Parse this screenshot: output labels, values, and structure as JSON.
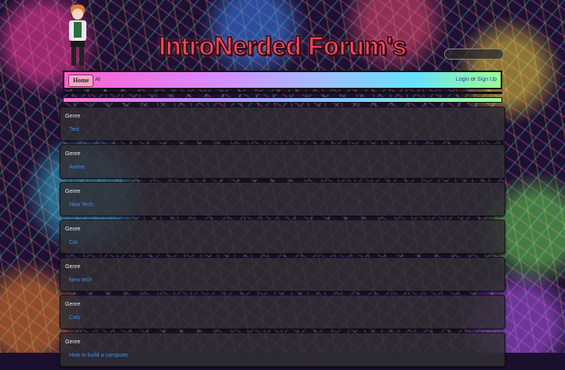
{
  "site": {
    "title": "IntroNerded Forum's"
  },
  "nav": {
    "home": "Home",
    "all": "All",
    "login": "Login",
    "or": "or",
    "signup": "Sign Up"
  },
  "categories": [
    {
      "genre": "Genre",
      "name": "Test"
    },
    {
      "genre": "Genre",
      "name": "Anime"
    },
    {
      "genre": "Genre",
      "name": "New Tech"
    },
    {
      "genre": "Genre",
      "name": "Cat"
    },
    {
      "genre": "Genre",
      "name": "New tech"
    },
    {
      "genre": "Genre",
      "name": "Cats"
    },
    {
      "genre": "Genre",
      "name": "How to build a computer"
    }
  ],
  "colors": {
    "title": "#f0475a",
    "link": "#3d8eea",
    "panel": "#302e34"
  },
  "icons": {
    "mascot": "anime-character-icon"
  }
}
